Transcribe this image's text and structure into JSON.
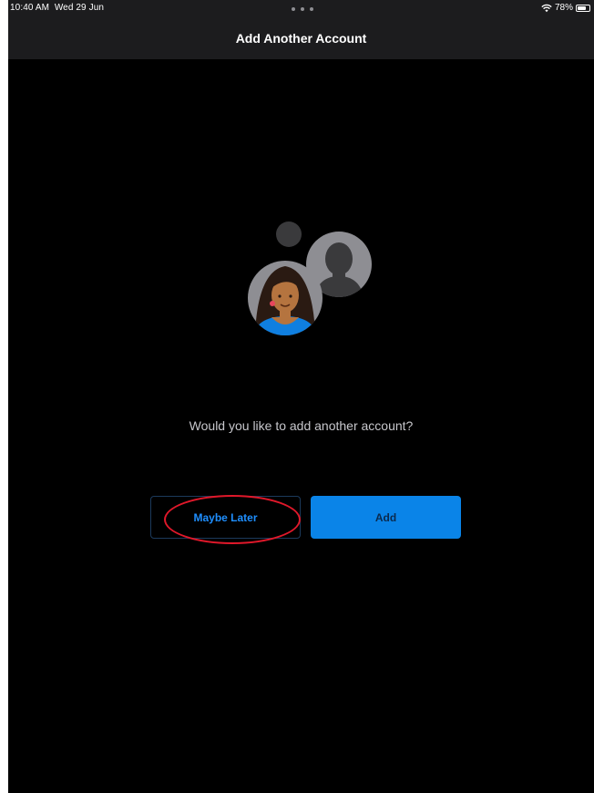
{
  "status_bar": {
    "time": "10:40 AM",
    "date": "Wed 29 Jun",
    "battery": "78%",
    "battery_level": 0.78,
    "icons": [
      "wifi-icon",
      "battery-icon",
      "more-dots-icon"
    ]
  },
  "nav": {
    "title": "Add Another Account"
  },
  "illustration": {
    "icon": "add-account-illustration",
    "skin_color": "#b5743f",
    "shirt_color": "#0f7fe0",
    "hair_color": "#2a1a12",
    "earring_color": "#e7465d"
  },
  "prompt": {
    "text": "Would you like to add another account?"
  },
  "buttons": {
    "maybe_later": "Maybe Later",
    "add": "Add"
  },
  "colors": {
    "background": "#000000",
    "bar": "#1c1c1e",
    "accent": "#0a84e8",
    "link": "#1f8fff",
    "annotation": "#e0182a"
  }
}
